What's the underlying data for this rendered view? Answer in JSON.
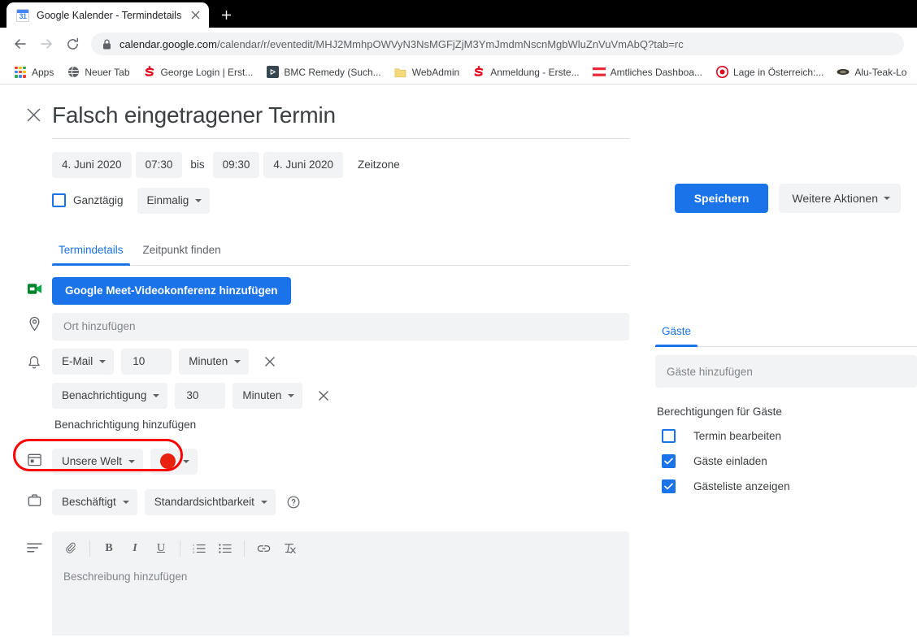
{
  "browser": {
    "tab": {
      "favicon": "google-calendar-favicon",
      "favicon_day": "31",
      "title": "Google Kalender - Termindetails",
      "close_label": "✕"
    },
    "new_tab_label": "+",
    "nav": {
      "back": "back-icon",
      "forward": "forward-icon",
      "reload": "reload-icon"
    },
    "omnibox": {
      "lock": "lock-icon",
      "host": "calendar.google.com",
      "path": "/calendar/r/eventedit/MHJ2MmhpOWVyN3NsMGFjZjM3YmJmdmNscnMgbWluZnVuVmAbQ?tab=rc"
    },
    "bookmarks": [
      {
        "label": "Apps",
        "icon": "apps-grid-icon"
      },
      {
        "label": "Neuer Tab",
        "icon": "globe-icon"
      },
      {
        "label": "George Login | Erst...",
        "icon": "sparkasse-icon"
      },
      {
        "label": "BMC Remedy (Such...",
        "icon": "play-square-icon"
      },
      {
        "label": "WebAdmin",
        "icon": "folder-icon"
      },
      {
        "label": "Anmeldung - Erste...",
        "icon": "sparkasse-icon"
      },
      {
        "label": "Amtliches Dashboa...",
        "icon": "austria-flag-icon"
      },
      {
        "label": "Lage in Österreich:...",
        "icon": "target-icon"
      },
      {
        "label": "Alu-Teak-Lo",
        "icon": "oval-icon"
      }
    ]
  },
  "event": {
    "close_icon": "close-icon",
    "title": "Falsch eingetragener Termin",
    "actions": {
      "save_label": "Speichern",
      "more_label": "Weitere Aktionen"
    },
    "schedule": {
      "start_date": "4. Juni 2020",
      "start_time": "07:30",
      "separator": "bis",
      "end_time": "09:30",
      "end_date": "4. Juni 2020",
      "timezone_label": "Zeitzone",
      "allday_label": "Ganztägig",
      "allday_checked": false,
      "recurrence": "Einmalig"
    },
    "tabs": [
      {
        "label": "Termindetails",
        "active": true
      },
      {
        "label": "Zeitpunkt finden",
        "active": false
      }
    ],
    "meet": {
      "icon": "google-meet-icon",
      "button_label": "Google Meet-Videokonferenz hinzufügen"
    },
    "location": {
      "icon": "location-pin-icon",
      "placeholder": "Ort hinzufügen"
    },
    "notifications": {
      "icon": "bell-icon",
      "rows": [
        {
          "type": "E-Mail",
          "amount": "10",
          "unit": "Minuten",
          "remove": "✕"
        },
        {
          "type": "Benachrichtigung",
          "amount": "30",
          "unit": "Minuten",
          "remove": "✕"
        }
      ],
      "add_label": "Benachrichtigung hinzufügen"
    },
    "calendar": {
      "icon": "calendar-icon",
      "name": "Unsere Welt",
      "color_hex": "#e8220e",
      "highlight_color": "#ff0000"
    },
    "availability": {
      "icon": "briefcase-icon",
      "busy": "Beschäftigt",
      "visibility": "Standardsichtbarkeit",
      "help_icon": "help-circle-icon"
    },
    "description": {
      "icon": "description-lines-icon",
      "placeholder": "Beschreibung hinzufügen",
      "toolbar": [
        {
          "name": "attach-icon",
          "glyph": "📎"
        },
        {
          "name": "bold-icon",
          "glyph": "B"
        },
        {
          "name": "italic-icon",
          "glyph": "I"
        },
        {
          "name": "underline-icon",
          "glyph": "U"
        },
        {
          "name": "numbered-list-icon",
          "glyph": ""
        },
        {
          "name": "bulleted-list-icon",
          "glyph": ""
        },
        {
          "name": "link-icon",
          "glyph": ""
        },
        {
          "name": "clear-formatting-icon",
          "glyph": ""
        }
      ]
    },
    "guests": {
      "tab_label": "Gäste",
      "add_placeholder": "Gäste hinzufügen",
      "permissions_title": "Berechtigungen für Gäste",
      "permissions": [
        {
          "label": "Termin bearbeiten",
          "checked": false
        },
        {
          "label": "Gäste einladen",
          "checked": true
        },
        {
          "label": "Gästeliste anzeigen",
          "checked": true
        }
      ]
    }
  },
  "colors": {
    "accent": "#1a73e8",
    "field_bg": "#f1f3f4",
    "text": "#3c4043",
    "muted": "#5f6368"
  }
}
